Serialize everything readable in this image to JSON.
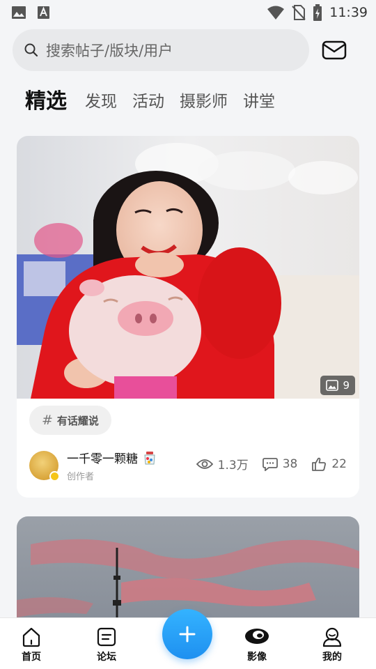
{
  "status_bar": {
    "time": "11:39"
  },
  "search": {
    "placeholder": "搜索帖子/版块/用户"
  },
  "tabs": [
    {
      "label": "精选"
    },
    {
      "label": "发现"
    },
    {
      "label": "活动"
    },
    {
      "label": "摄影师"
    },
    {
      "label": "讲堂"
    }
  ],
  "post": {
    "image_count": "9",
    "topic": "有话耀说",
    "author_name": "一千零一颗糖",
    "author_role": "创作者",
    "views": "1.3万",
    "comments": "38",
    "likes": "22"
  },
  "bottom_nav": {
    "home": "首页",
    "forum": "论坛",
    "imaging": "影像",
    "mine": "我的"
  },
  "colors": {
    "accent": "#1e90f0",
    "background": "#f4f5f7"
  }
}
